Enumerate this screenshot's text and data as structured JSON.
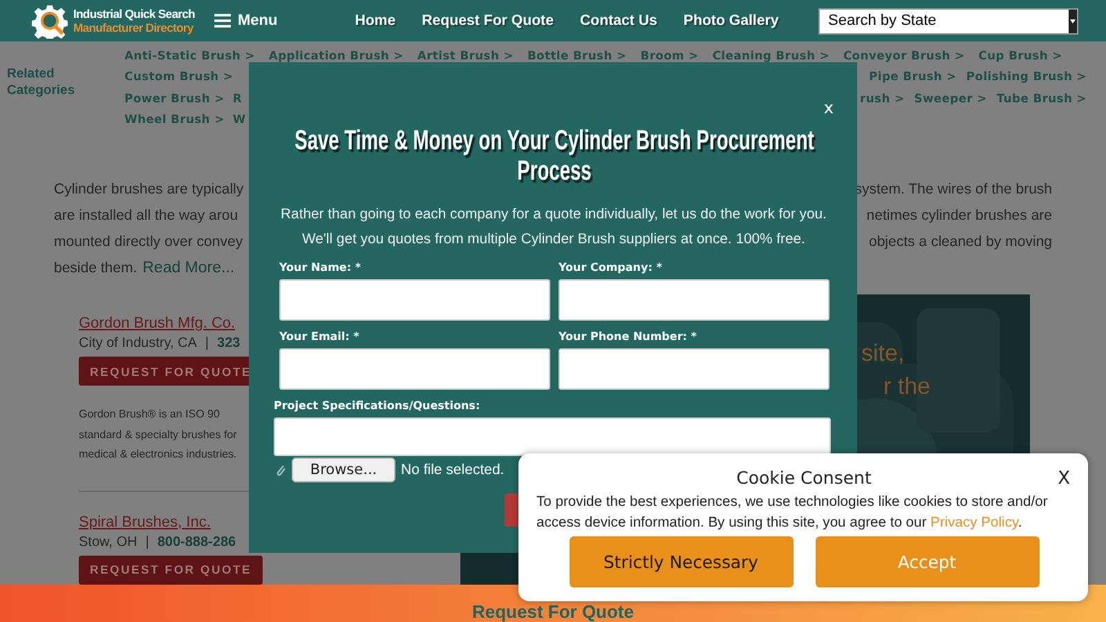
{
  "header": {
    "logo": {
      "line_1": "Industrial Quick Search",
      "line_2": "Manufacturer Directory"
    },
    "menu_button": "Menu",
    "nav": [
      "Home",
      "Request For Quote",
      "Contact Us",
      "Photo Gallery"
    ],
    "state_select": {
      "value": "Search by State"
    }
  },
  "related_categories": {
    "title": "Related Categories",
    "rows": [
      {
        "left": [
          "Anti-Static Brush >",
          "Application Brush >",
          "Artist Brush >",
          "Bottle Brush >",
          "Broom >",
          "Cleaning Brush >",
          "Conveyor Brush >",
          "Cup Brush >"
        ],
        "right": []
      },
      {
        "left": [
          "Custom Brush >"
        ],
        "right": [
          "Pipe Brush >",
          "Polishing Brush >"
        ]
      },
      {
        "left": [
          "Power Brush >",
          "R"
        ],
        "right": [
          "rush >",
          "Sweeper >",
          "Tube Brush >"
        ]
      },
      {
        "left": [
          "Wheel Brush >",
          "W"
        ],
        "right": []
      }
    ]
  },
  "intro": {
    "lines": [
      {
        "left": "Cylinder brushes are typically",
        "right": "system. The wires of the brush"
      },
      {
        "left": "are installed all the way arou",
        "right": "netimes cylinder brushes are"
      },
      {
        "left": "mounted directly over convey",
        "right": "objects a cleaned by moving"
      },
      {
        "left": "beside them."
      }
    ],
    "read_more": "Read More..."
  },
  "listings": [
    {
      "name": "Gordon Brush Mfg. Co.",
      "location": "City of Industry, CA",
      "separator": "|",
      "phone": "323",
      "button": "REQUEST FOR QUOTE",
      "description": [
        "Gordon Brush® is an ISO 90",
        "standard & specialty brushes for",
        "medical & electronics industries."
      ]
    },
    {
      "name": "Spiral Brushes, Inc.",
      "location": "Stow, OH",
      "separator": "|",
      "phone": "800-888-286",
      "button": "REQUEST FOR QUOTE"
    }
  ],
  "banner": {
    "lines": [
      "site,",
      "r the"
    ]
  },
  "footer_bar": {
    "label": "Request For Quote"
  },
  "modal": {
    "close": "x",
    "title": "Save Time & Money on Your Cylinder Brush Procurement Process",
    "intro": "Rather than going to each company for a quote individually, let us do the work for you. We'll get you quotes from multiple Cylinder Brush suppliers at once. 100% free.",
    "fields": [
      {
        "label": "Your Name: *",
        "kind": "input"
      },
      {
        "label": "Your Company: *",
        "kind": "input"
      },
      {
        "label": "Your Email: *",
        "kind": "input"
      },
      {
        "label": "Your Phone Number: *",
        "kind": "input"
      },
      {
        "label": "Project Specifications/Questions:",
        "kind": "textarea"
      }
    ],
    "file": {
      "button": "Browse...",
      "status": "No file selected."
    }
  },
  "cookie": {
    "title": "Cookie Consent",
    "close": "X",
    "text": "To provide the best experiences, we use technologies like cookies to store and/or access device information. By using this site, you agree to our",
    "link": "Privacy Policy",
    "end": ".",
    "buttons": [
      {
        "label": "Strictly Necessary",
        "kind": "secondary"
      },
      {
        "label": "Accept",
        "kind": "primary"
      }
    ]
  }
}
